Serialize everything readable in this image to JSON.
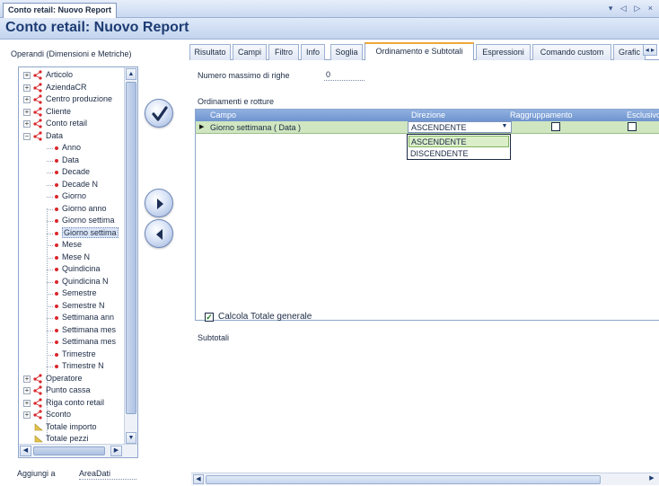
{
  "window": {
    "doc_tab": "Conto retail: Nuovo Report",
    "tab_nav": "▾ ◁ ▷ ×",
    "title": "Conto retail: Nuovo Report"
  },
  "left_panel": {
    "header": "Operandi (Dimensioni e Metriche)",
    "tree": [
      {
        "label": "Articolo",
        "type": "dimension",
        "expanded": false
      },
      {
        "label": "AziendaCR",
        "type": "dimension",
        "expanded": false
      },
      {
        "label": "Centro produzione",
        "type": "dimension",
        "expanded": false
      },
      {
        "label": "Cliente",
        "type": "dimension",
        "expanded": false
      },
      {
        "label": "Conto retail",
        "type": "dimension",
        "expanded": false
      },
      {
        "label": "Data",
        "type": "dimension",
        "expanded": true
      },
      {
        "label": "Anno",
        "type": "attribute"
      },
      {
        "label": "Data",
        "type": "attribute"
      },
      {
        "label": "Decade",
        "type": "attribute"
      },
      {
        "label": "Decade N",
        "type": "attribute"
      },
      {
        "label": "Giorno",
        "type": "attribute"
      },
      {
        "label": "Giorno anno",
        "type": "attribute"
      },
      {
        "label": "Giorno settima",
        "type": "attribute"
      },
      {
        "label": "Giorno settima",
        "type": "attribute",
        "selected": true
      },
      {
        "label": "Mese",
        "type": "attribute"
      },
      {
        "label": "Mese N",
        "type": "attribute"
      },
      {
        "label": "Quindicina",
        "type": "attribute"
      },
      {
        "label": "Quindicina N",
        "type": "attribute"
      },
      {
        "label": "Semestre",
        "type": "attribute"
      },
      {
        "label": "Semestre N",
        "type": "attribute"
      },
      {
        "label": "Settimana ann",
        "type": "attribute"
      },
      {
        "label": "Settimana mes",
        "type": "attribute"
      },
      {
        "label": "Settimana mes",
        "type": "attribute"
      },
      {
        "label": "Trimestre",
        "type": "attribute"
      },
      {
        "label": "Trimestre N",
        "type": "attribute"
      },
      {
        "label": "Operatore",
        "type": "dimension",
        "expanded": false
      },
      {
        "label": "Punto cassa",
        "type": "dimension",
        "expanded": false
      },
      {
        "label": "Riga conto retail",
        "type": "dimension",
        "expanded": false
      },
      {
        "label": "Sconto",
        "type": "dimension",
        "expanded": false
      },
      {
        "label": "Totale importo",
        "type": "metric"
      },
      {
        "label": "Totale pezzi",
        "type": "metric"
      }
    ],
    "add_to_label": "Aggiungi a",
    "add_to_value": "AreaDati"
  },
  "tabs": [
    {
      "label": "Risultato",
      "active": false
    },
    {
      "label": "Campi",
      "active": false
    },
    {
      "label": "Filtro",
      "active": false
    },
    {
      "label": "Info",
      "active": false
    },
    {
      "label": "Soglia",
      "active": false
    },
    {
      "label": "Ordinamento e Subtotali",
      "active": true
    },
    {
      "label": "Espressioni",
      "active": false
    },
    {
      "label": "Comando custom",
      "active": false
    },
    {
      "label": "Grafic",
      "active": false
    }
  ],
  "tab_scroll": "◂ ▸",
  "sorting": {
    "max_rows_label": "Numero massimo di righe",
    "max_rows_value": "0",
    "orders_label": "Ordinamenti e rotture",
    "columns": {
      "field": "Campo",
      "direction": "Direzione",
      "grouping": "Raggruppamento",
      "exclusive": "Esclusivo"
    },
    "row": {
      "marker": "▶",
      "field": "Giorno settimana ( Data )",
      "direction": "ASCENDENTE",
      "grouping": false,
      "exclusive": false
    },
    "direction_options": [
      "ASCENDENTE",
      "DISCENDENTE"
    ],
    "total_label": "Calcola Totale generale",
    "total_checked": true,
    "subtotals_label": "Subtotali"
  },
  "colors": {
    "accent": "#f0a63a",
    "header_blue": "#6f94cf",
    "row_green": "#cfe6c0",
    "leaf_red": "#d9252a",
    "title_blue": "#1d3c73"
  }
}
